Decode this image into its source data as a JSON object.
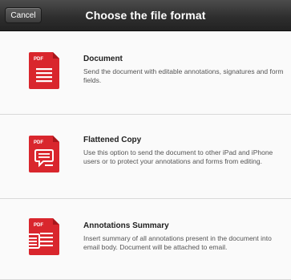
{
  "navbar": {
    "cancel_label": "Cancel",
    "title": "Choose the file format"
  },
  "items": [
    {
      "icon_text": "PDF",
      "title": "Document",
      "description": "Send the document with editable annotations, signatures and form fields.",
      "icon": "pdf-document-icon"
    },
    {
      "icon_text": "PDF",
      "title": "Flattened Copy",
      "description": "Use this option to send the document to other iPad and iPhone users or to protect your annotations and forms from editing.",
      "icon": "pdf-flattened-icon"
    },
    {
      "icon_text": "PDF",
      "title": "Annotations Summary",
      "description": "Insert summary of all annotations present in the document into email body. Document will be attached to email.",
      "icon": "pdf-summary-icon"
    }
  ],
  "colors": {
    "accent": "#d9262d"
  }
}
